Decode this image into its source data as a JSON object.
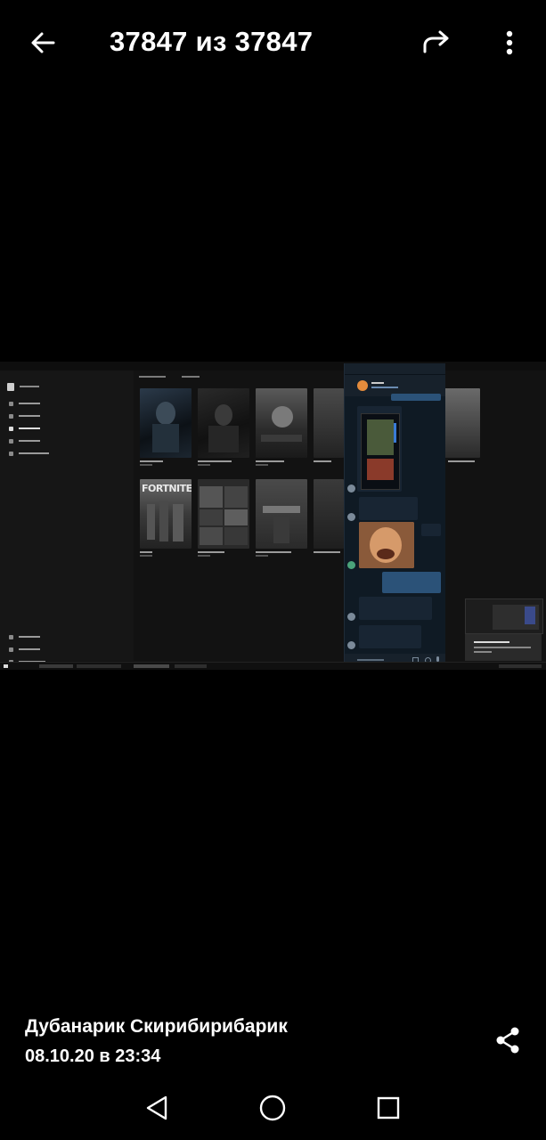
{
  "header": {
    "counter": "37847 из 37847",
    "back_icon": "arrow-left-icon",
    "forward_icon": "forward-arrow-icon",
    "more_icon": "more-vertical-icon"
  },
  "caption": {
    "author": "Дубанарик Скирибирибарик",
    "datetime": "08.10.20 в 23:34",
    "share_icon": "share-icon"
  },
  "navbar": {
    "back_icon": "triangle-back-icon",
    "home_icon": "circle-home-icon",
    "recent_icon": "square-recent-icon"
  },
  "photo": {
    "tile_logo": "FORTNITE"
  }
}
